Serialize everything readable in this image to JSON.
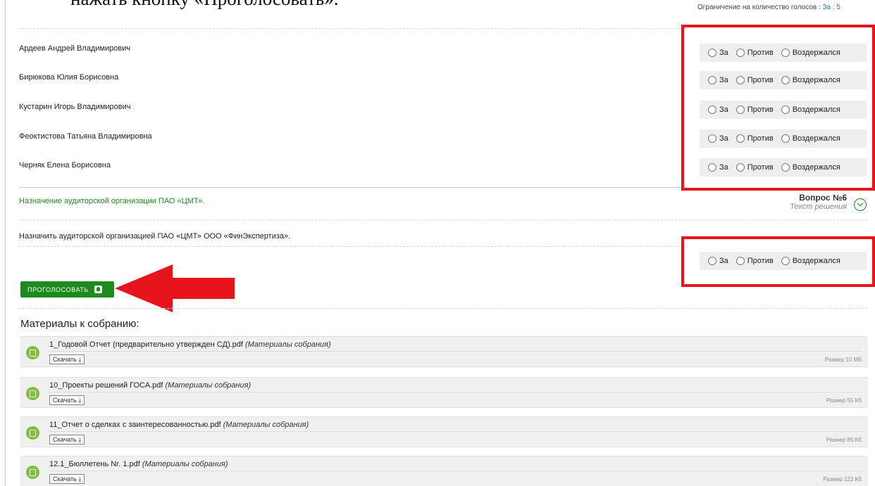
{
  "page": {
    "heading_fragment": "нажать кнопку «Проголосовать».",
    "vote_limit": {
      "label": "Ограничение на количество голосов :",
      "value": "За : 5"
    }
  },
  "vote_options": [
    "За",
    "Против",
    "Воздержался"
  ],
  "candidates": [
    "Ардеев Андрей Владимирович",
    "Бирюкова Юлия Борисовна",
    "Кустарин Игорь Владимирович",
    "Феоктистова Татьяна Владимировна",
    "Черняк Елена Борисовна"
  ],
  "question": {
    "title": "Назначение аудиторской организации ПАО «ЦМТ».",
    "number": "Вопрос №6",
    "subtitle": "Текст решения",
    "decision_text": "Назначить аудиторской организацией ПАО «ЦМТ» ООО «ФинЭкспертиза»."
  },
  "vote_button": {
    "label": "ПРОГОЛОСОВАТЬ",
    "icon": "bell-icon"
  },
  "materials": {
    "title": "Материалы к собранию:",
    "download_label": "Скачать ⤓",
    "category": "(Материалы собрания)",
    "files": [
      {
        "name": "1_Годовой Отчет (предварительно утвержден СД).pdf",
        "size": "Размер 10 Мб."
      },
      {
        "name": "10_Проекты решений ГОСА.pdf",
        "size": "Размер 55 Кб."
      },
      {
        "name": "11_Отчет о сделках с заинтересованностью.pdf",
        "size": "Размер 85 Кб."
      },
      {
        "name": "12.1_Бюллетень Nr. 1.pdf",
        "size": "Размер 122 Кб."
      }
    ]
  },
  "colors": {
    "accent_green": "#1d8a1d",
    "annotation_red": "#e8141c",
    "pdf_icon_green": "#7fbf3a"
  }
}
